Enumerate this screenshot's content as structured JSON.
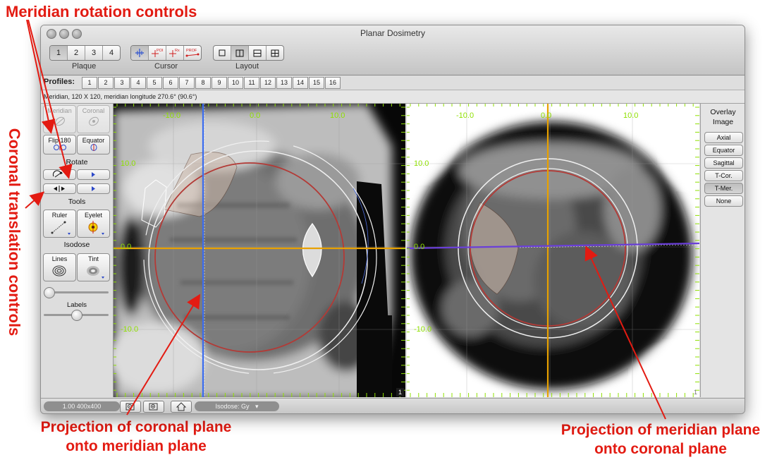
{
  "annotations": {
    "meridian_rotation": "Meridian rotation controls",
    "coronal_translation": "Coronal translation controls",
    "proj_coronal_line1": "Projection of coronal plane",
    "proj_coronal_line2": "onto meridian plane",
    "proj_meridian_line1": "Projection of meridian plane",
    "proj_meridian_line2": "onto coronal plane"
  },
  "window": {
    "title": "Planar Dosimetry"
  },
  "toolbar": {
    "plaque": {
      "label": "Plaque",
      "items": [
        "1",
        "2",
        "3",
        "4"
      ],
      "selected": "1"
    },
    "cursor": {
      "label": "Cursor",
      "icons": [
        "crosshair-icon",
        "poi-cursor-icon",
        "rx-cursor-icon",
        "profile-cursor-icon"
      ],
      "icon_text": [
        "POI",
        "Rx",
        "PROF"
      ]
    },
    "layout": {
      "label": "Layout",
      "icons": [
        "single-layout-icon",
        "split-vertical-icon",
        "split-horizontal-icon",
        "quad-layout-icon"
      ]
    }
  },
  "profiles": {
    "label": "Profiles:",
    "items": [
      "1",
      "2",
      "3",
      "4",
      "5",
      "6",
      "7",
      "8",
      "9",
      "10",
      "11",
      "12",
      "13",
      "14",
      "15",
      "16"
    ]
  },
  "status_line": "Meridian, 120 X 120, meridian longitude 270.6° (90.6°)",
  "left_panel": {
    "meridian": "Meridian",
    "coronal": "Coronal",
    "flip": "Flip 180",
    "equator": "Equator",
    "rotate_title": "Rotate",
    "tools_title": "Tools",
    "ruler": "Ruler",
    "eyelet": "Eyelet",
    "isodose_title": "Isodose",
    "lines": "Lines",
    "tint": "Tint",
    "labels": "Labels"
  },
  "views": {
    "left": {
      "ticks_top": [
        "-10.0",
        "0.0",
        "10.0"
      ],
      "ticks_left": [
        "10.0",
        "0.0",
        "-10.0"
      ],
      "view_number": "1"
    },
    "right": {
      "ticks_top": [
        "-10.0",
        "0.0",
        "10.0"
      ],
      "ticks_left": [
        "10.0",
        "0.0",
        "-10.0"
      ],
      "view_number": "1"
    }
  },
  "right_panel": {
    "title_line1": "Overlay",
    "title_line2": "Image",
    "buttons": [
      "Axial",
      "Equator",
      "Sagittal",
      "T-Cor.",
      "T-Mer.",
      "None"
    ],
    "selected": "T-Mer."
  },
  "bottom_bar": {
    "zoom_readout": "1.00 400x400",
    "isodose_select": "Isodose: Gy"
  },
  "colors": {
    "annotation": "#e31b12",
    "axis_tick": "#8fe000",
    "orange_line": "#e8a100",
    "blue_line": "#3a6cf0",
    "purple_line": "#6a3fd8",
    "red_circle": "#b33a36"
  }
}
